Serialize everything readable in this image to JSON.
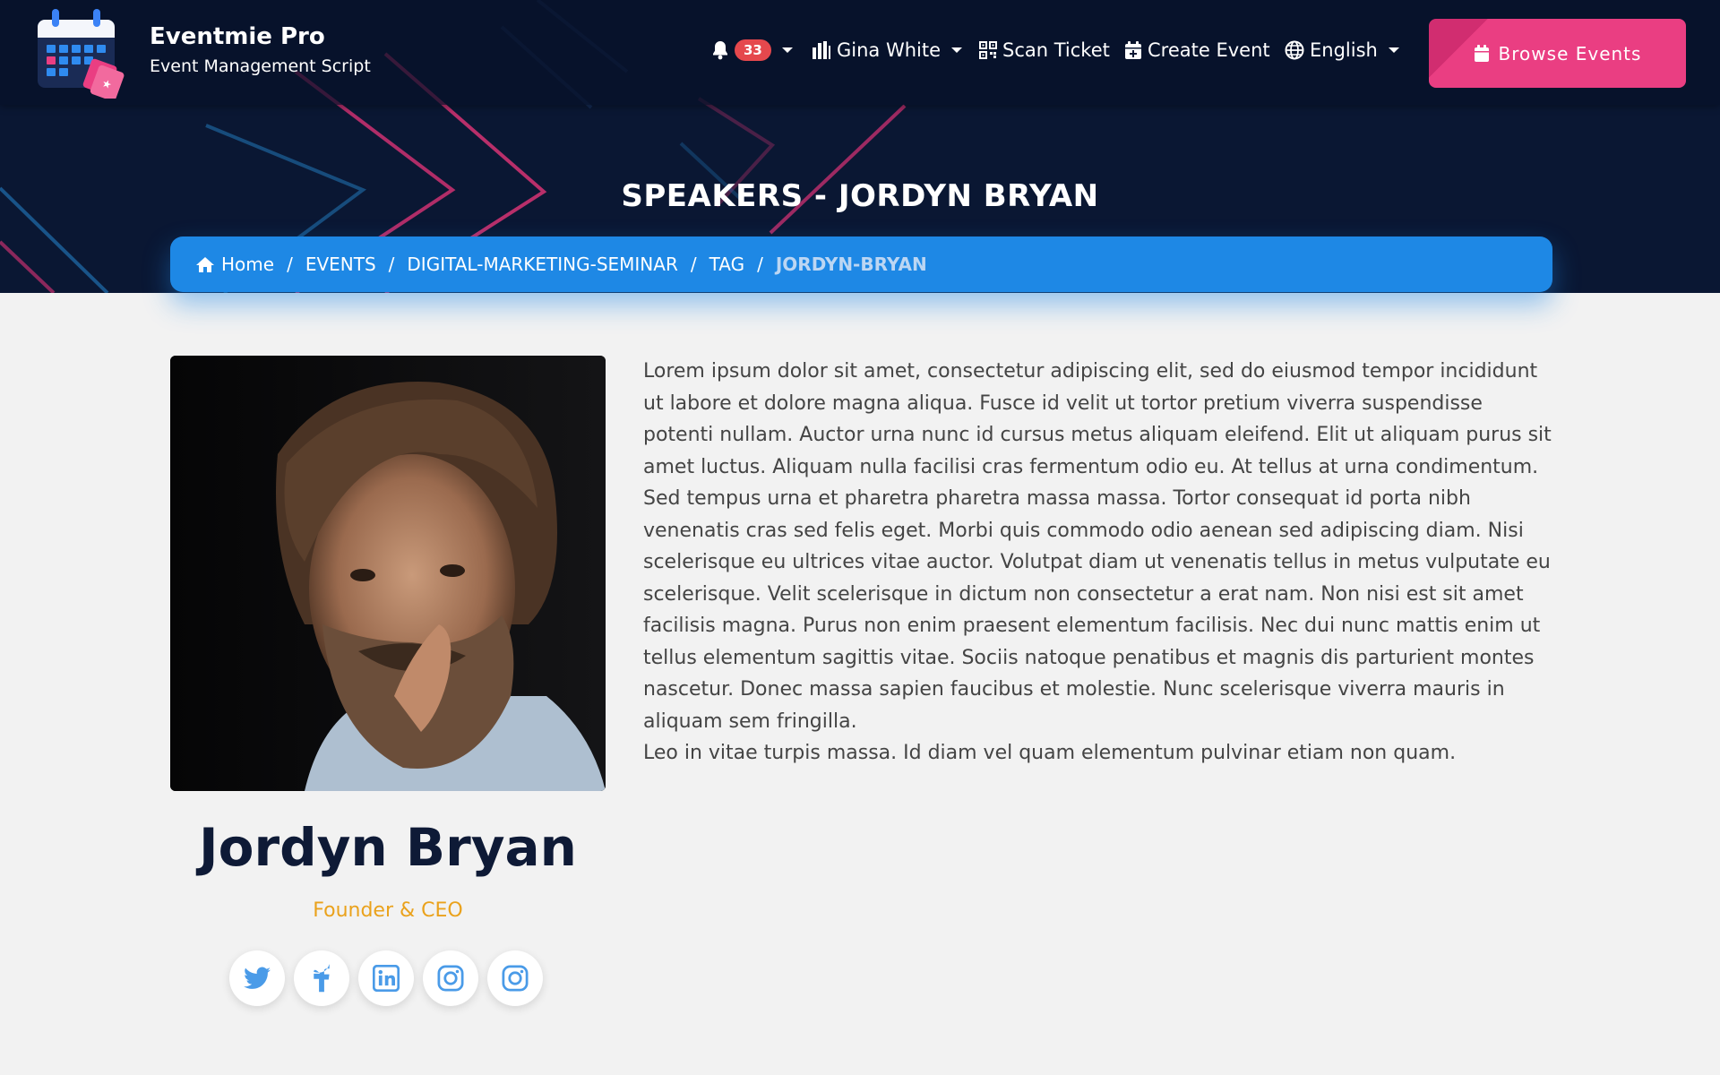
{
  "brand": {
    "name": "Eventmie Pro",
    "tagline": "Event Management Script"
  },
  "nav": {
    "notifications_count": "33",
    "user_name": "Gina White",
    "scan_ticket": "Scan Ticket",
    "create_event": "Create Event",
    "language": "English",
    "browse_events": "Browse Events"
  },
  "page": {
    "title": "SPEAKERS - JORDYN BRYAN"
  },
  "breadcrumb": {
    "items": [
      "Home",
      "EVENTS",
      "DIGITAL-MARKETING-SEMINAR",
      "TAG",
      "JORDYN-BRYAN"
    ]
  },
  "speaker": {
    "name": "Jordyn Bryan",
    "role": "Founder & CEO",
    "bio": [
      "Lorem ipsum dolor sit amet, consectetur adipiscing elit, sed do eiusmod tempor incididunt ut labore et dolore magna aliqua. Fusce id velit ut tortor pretium viverra suspendisse potenti nullam. Auctor urna nunc id cursus metus aliquam eleifend. Elit ut aliquam purus sit amet luctus. Aliquam nulla facilisi cras fermentum odio eu. At tellus at urna condimentum. Sed tempus urna et pharetra pharetra massa massa. Tortor consequat id porta nibh venenatis cras sed felis eget. Morbi quis commodo odio aenean sed adipiscing diam. Nisi scelerisque eu ultrices vitae auctor. Volutpat diam ut venenatis tellus in metus vulputate eu scelerisque. Velit scelerisque in dictum non consectetur a erat nam. Non nisi est sit amet facilisis magna. Purus non enim praesent elementum facilisis. Nec dui nunc mattis enim ut tellus elementum sagittis vitae. Sociis natoque penatibus et magnis dis parturient montes nascetur. Donec massa sapien faucibus et molestie. Nunc scelerisque viverra mauris in aliquam sem fringilla.",
      "Leo in vitae turpis massa. Id diam vel quam elementum pulvinar etiam non quam."
    ],
    "socials": [
      "twitter-icon",
      "facebook-icon",
      "linkedin-icon",
      "instagram-icon",
      "instagram-icon"
    ]
  },
  "colors": {
    "header_bg": "#0a1733",
    "accent_pink": "#ea3e82",
    "breadcrumb_blue": "#1e88e5",
    "role_gold": "#eaa21c",
    "name_navy": "#0e1a36"
  }
}
